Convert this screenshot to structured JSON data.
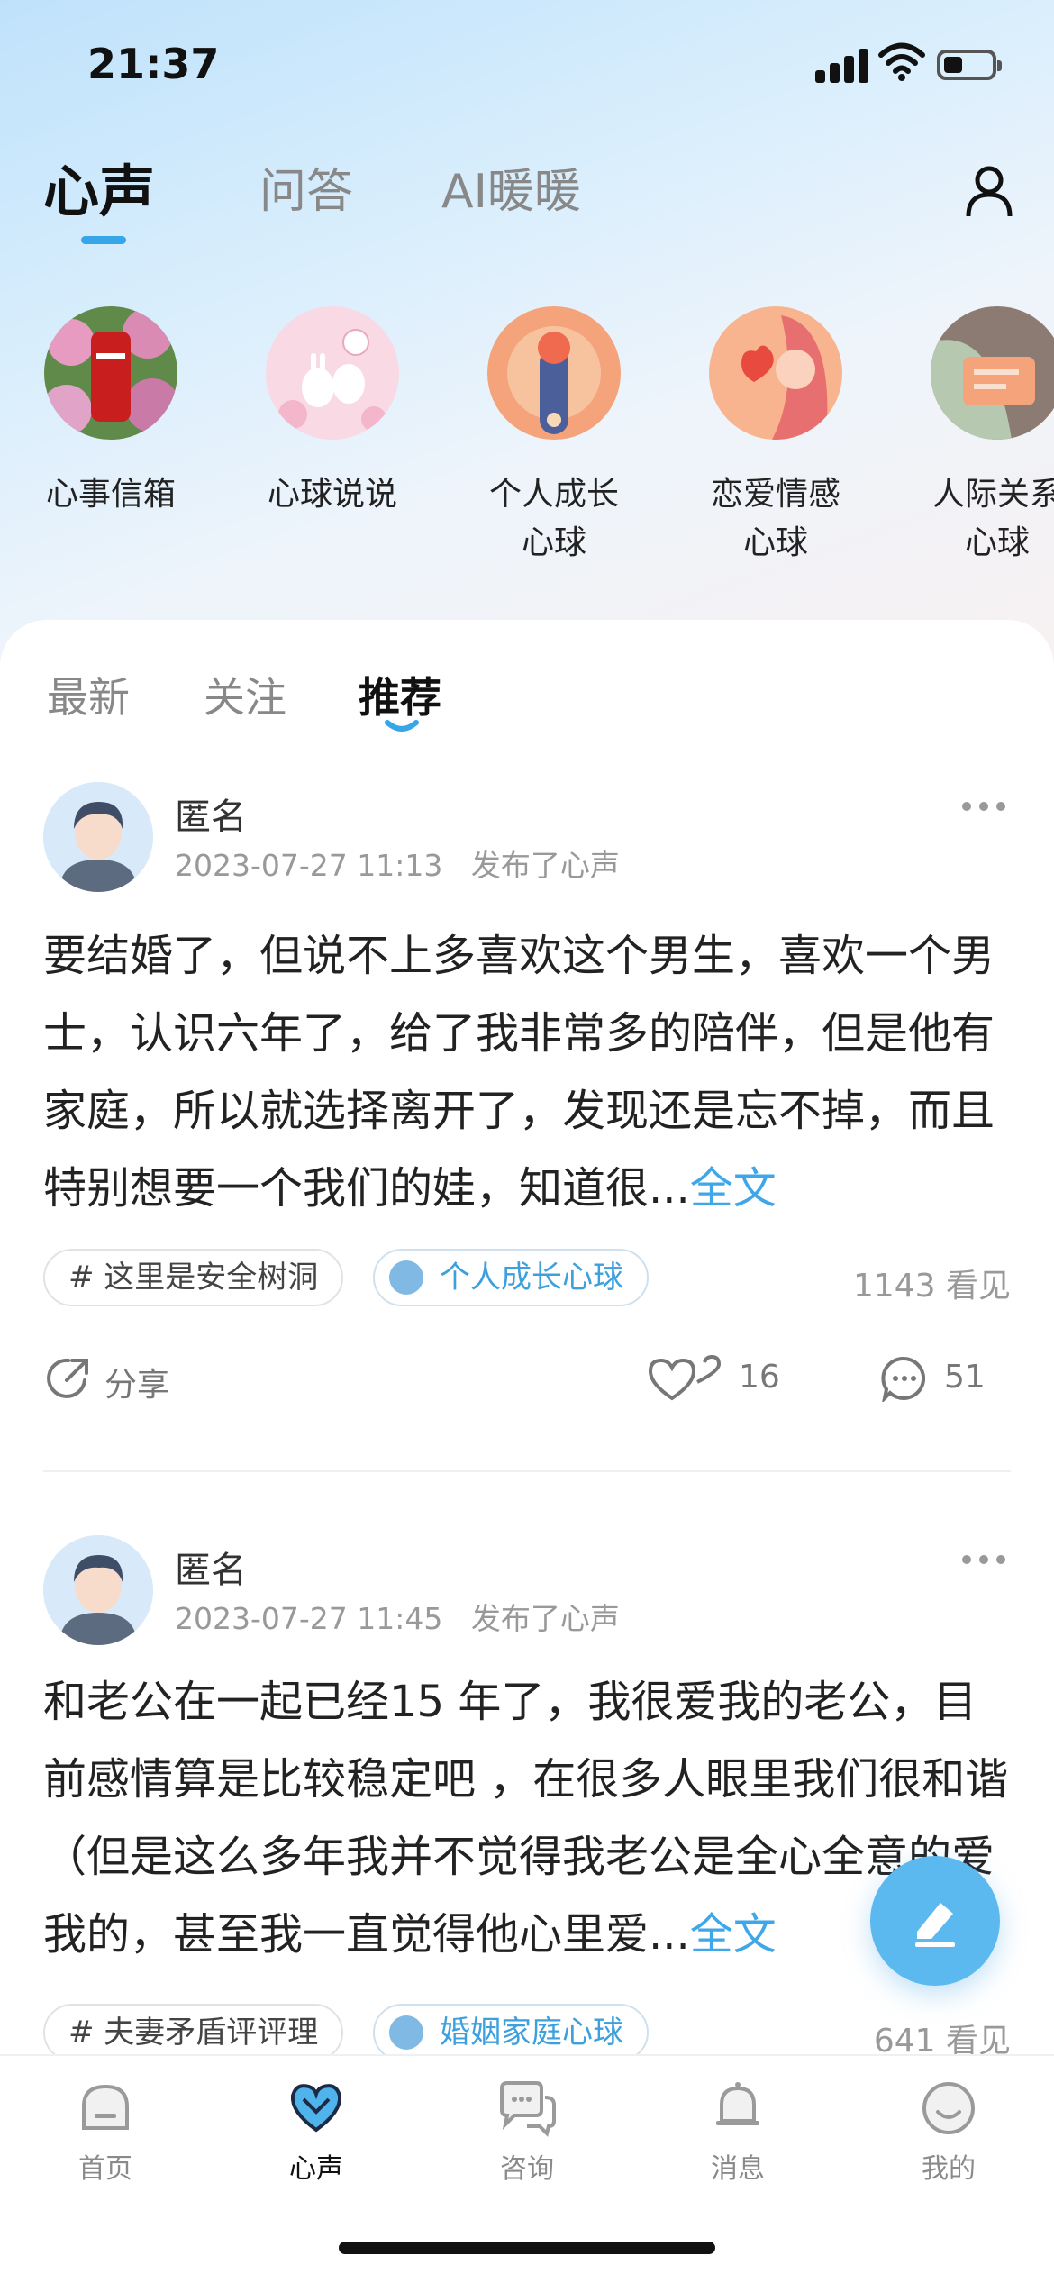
{
  "status_bar": {
    "time": "21:37"
  },
  "top_tabs": [
    "心声",
    "问答",
    "AI暖暖"
  ],
  "circles": [
    {
      "name": "心事信箱"
    },
    {
      "name": "心球说说"
    },
    {
      "name": "个人成长\n心球"
    },
    {
      "name": "恋爱情感\n心球"
    },
    {
      "name": "人际关系\n心球"
    }
  ],
  "sub_tabs": [
    "最新",
    "关注",
    "推荐"
  ],
  "posts": [
    {
      "author": "匿名",
      "time": "2023-07-27 11:13",
      "action": "发布了心声",
      "text": "要结婚了，但说不上多喜欢这个男生，喜欢一个男士，认识六年了，给了我非常多的陪伴，但是他有家庭，所以就选择离开了，发现还是忘不掉，而且特别想要一个我们的娃，知道很...",
      "read_more": "全文",
      "topic": "# 这里是安全树洞",
      "circle": "个人成长心球",
      "views": "1143 看见",
      "share": "分享",
      "likes": "16",
      "comments": "51"
    },
    {
      "author": "匿名",
      "time": "2023-07-27 11:45",
      "action": "发布了心声",
      "text": "和老公在一起已经15 年了，我很爱我的老公，目前感情算是比较稳定吧 ，在很多人眼里我们很和谐（但是这么多年我并不觉得我老公是全心全意的爱我的，甚至我一直觉得他心里爱...",
      "read_more": "全文",
      "topic": "# 夫妻矛盾评评理",
      "circle": "婚姻家庭心球",
      "views": "641 看见"
    }
  ],
  "bottom_nav": [
    "首页",
    "心声",
    "咨询",
    "消息",
    "我的"
  ],
  "colors": {
    "accent": "#3fa7e8",
    "fab": "#5cb9f0"
  }
}
